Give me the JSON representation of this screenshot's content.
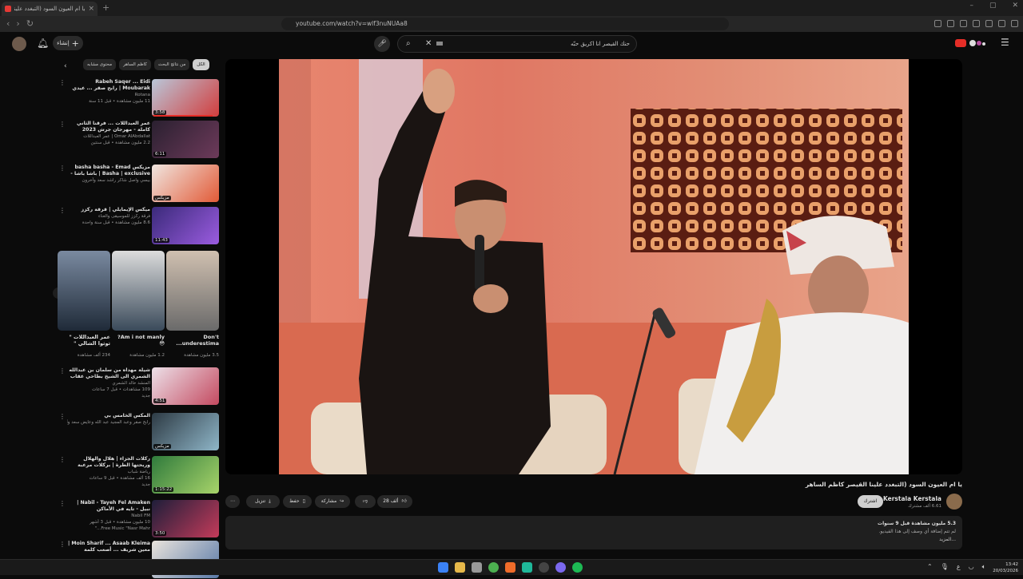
{
  "browser": {
    "tab_title": "يا ام العيون السود (التبغدد علينا القيصر كاظم الساهر",
    "new_tab": "+",
    "url": "youtube.com/watch?v=wlf3nuNUAa8",
    "win_min": "–",
    "win_max": "▢",
    "win_close": "✕"
  },
  "yt": {
    "create_label": "إنشاء",
    "search_query": "حنك القيصر انا اكريق حبّه",
    "chips": [
      "الكل",
      "من نتائج البحث",
      "كاظم الساهر",
      "محتوى مشابه"
    ]
  },
  "sidebar_videos": [
    {
      "title": "Rabeh Saqer ... Eidi Moubarak | رابح صقر ... عيدي مبارك",
      "channel": "Rotana",
      "meta": "11 مليون مشاهدة • قبل 11 سنة",
      "duration": "3:58",
      "progress": 0.9
    },
    {
      "title": "عمر العبداللات ... فرقنا الثاني كاملة - مهرجان جرش 2023",
      "channel": "Omar AlAbdallat | عمر العبداللات",
      "meta": "2.2 مليون مشاهدة • قبل سنتين",
      "duration": "6:11",
      "progress": 0
    },
    {
      "title": "مزيكس basha basha - Emad Basha | exclusive | باشا باشا - عماد باشا",
      "channel": "بيسي واصل شاكر راشد سعد وآخرون",
      "meta": "",
      "duration": "مزيكس",
      "progress": 0
    },
    {
      "title": "ميكس الإيمايلي | قرقة ركزز",
      "channel": "فرقة ركزز للموسيقى والغناء",
      "meta": "8.6 مليون مشاهدة • قبل سنة واحدة",
      "duration": "11:43",
      "progress": 0
    }
  ],
  "shorts": [
    {
      "title": "Don't underestima...",
      "views": "3.5 مليون مشاهدة"
    },
    {
      "title": "Am i not manly? 😳",
      "views": "1.2 مليون مشاهدة"
    },
    {
      "title": "عمر العبداللات \" ثوثوا الشالي \"",
      "views": "234 ألف مشاهدة"
    }
  ],
  "sidebar_videos2": [
    {
      "title": "شيلة مهداه من سلمان بن عبدالله الشمري الى الشيخ بطاحي عقاب العتيبي بمناسبة زواج ابنه...",
      "channel": "المنشد خالد الشمري",
      "meta": "109 مشاهدات • قبل 7 ساعات",
      "duration": "4:51",
      "badge": "جديد"
    },
    {
      "title": "المكس الخامس بي",
      "channel": "رابح صقر وعبد المجيد عبد الله وعايض سعد وآخرون",
      "meta": "",
      "duration": "مزيكس"
    },
    {
      "title": "ركلات الجزاء | هلال والهلال وربحتها الطرة | بركلات مرعبة",
      "channel": "رياضة شباب",
      "meta": "16 ألف مشاهدة • قبل 9 ساعات",
      "duration": "1:15:22",
      "badge": "جديد"
    },
    {
      "title": "Nabil - Tayeh Fel Amaken | نبيل - تايه في الأماكن",
      "channel": "Nabil FM",
      "meta": "10 مليون مشاهدة • قبل 3 أشهر",
      "duration": "3:50",
      "channel_extra": "Free Music \"Nasr Mahr...\""
    },
    {
      "title": "Moin Sharif ... Asaab Kleima | معين شريف ... أصعب كلمة",
      "channel": "",
      "meta": "",
      "duration": ""
    }
  ],
  "watch": {
    "title": "يا ام العيون السود (التبغدد علينا القيصر كاظم الساهر",
    "channel": "Kerstala Kerstala",
    "subs": "6.61 ألف مشترك",
    "join": "اشترك",
    "likes": "28 ألف",
    "share": "مشاركة",
    "save": "حفظ",
    "download": "تنزيل",
    "views_time": "5.3 مليون مشاهدة قبل 9 سنوات",
    "description": "لم تتم إضافة أي وصف إلى هذا الفيديو.",
    "more": "...المزيد"
  },
  "taskbar": {
    "time": "13:42",
    "date": "20/03/2026",
    "lang": "ع"
  },
  "colors": {
    "accent": "#e52d27",
    "bg": "#0b0b0b"
  }
}
